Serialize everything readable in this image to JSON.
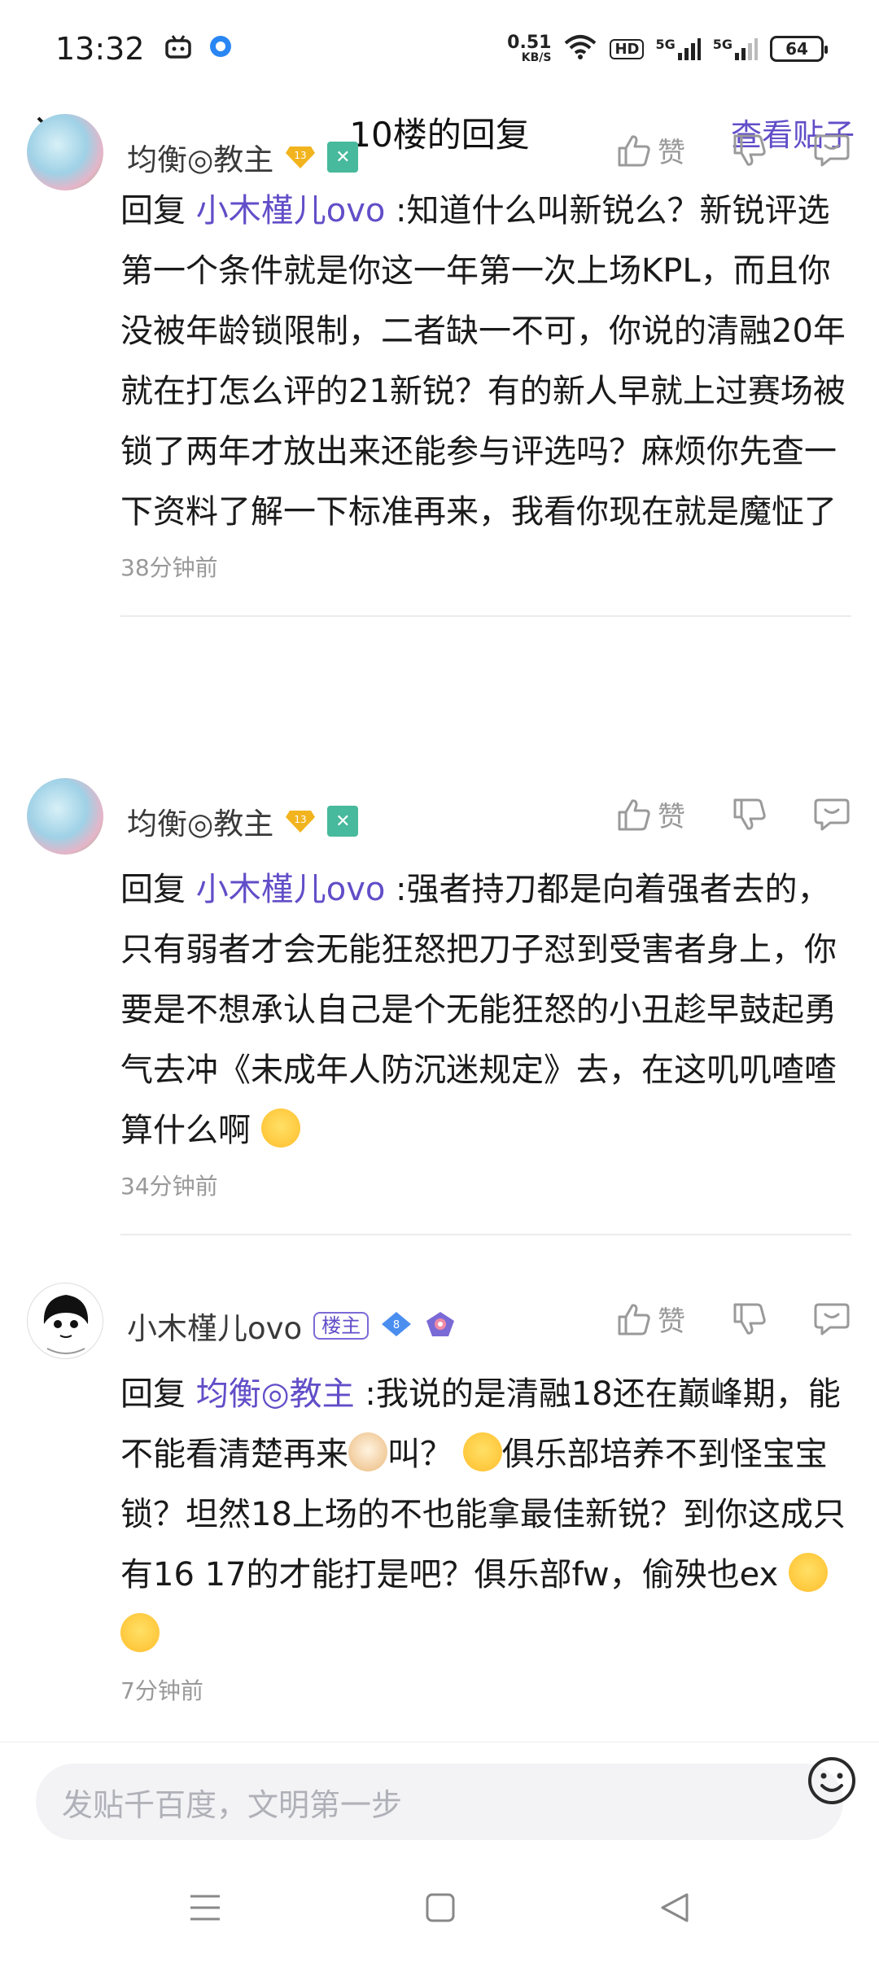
{
  "status_bar": {
    "time": "13:32",
    "net_speed_value": "0.51",
    "net_speed_unit": "KB/S",
    "hd_label": "HD",
    "signal1": "5G",
    "signal2": "5G",
    "battery": "64"
  },
  "header": {
    "title": "10楼的回复",
    "view_post": "查看贴子"
  },
  "replies": [
    {
      "username": "均衡◎教主",
      "level": "13",
      "like_label": "赞",
      "prefix": "回复 ",
      "mention": "小木槿儿ovo",
      "text": " :知道什么叫新锐么？新锐评选第一个条件就是你这一年第一次上场KPL，而且你没被年龄锁限制，二者缺一不可，你说的清融20年就在打怎么评的21新锐？有的新人早就上过赛场被锁了两年才放出来还能参与评选吗？麻烦你先查一下资料了解一下标准再来，我看你现在就是魔怔了",
      "time": "38分钟前"
    },
    {
      "username": "均衡◎教主",
      "level": "13",
      "like_label": "赞",
      "prefix": "回复 ",
      "mention": "小木槿儿ovo",
      "text": " :强者持刀都是向着强者去的，只有弱者才会无能狂怒把刀子怼到受害者身上，你要是不想承认自己是个无能狂怒的小丑趁早鼓起勇气去冲《未成年人防沉迷规定》去，在这叽叽喳喳算什么啊",
      "time": "34分钟前"
    },
    {
      "username": "小木槿儿ovo",
      "owner_tag": "楼主",
      "level": "8",
      "like_label": "赞",
      "prefix": "回复 ",
      "mention": "均衡◎教主",
      "text_a": " :我说的是清融18还在巅峰期，能不能看清楚再来",
      "text_b": "叫？",
      "text_c": "俱乐部培养不到怪宝宝锁？坦然18上场的不也能拿最佳新锐？到你这成只有16 17的才能打是吧？俱乐部fw，偷殃也ex",
      "time": "7分钟前"
    }
  ],
  "composer": {
    "placeholder": "发贴千百度，文明第一步"
  },
  "colors": {
    "accent": "#614ec8",
    "muted": "#999999"
  }
}
